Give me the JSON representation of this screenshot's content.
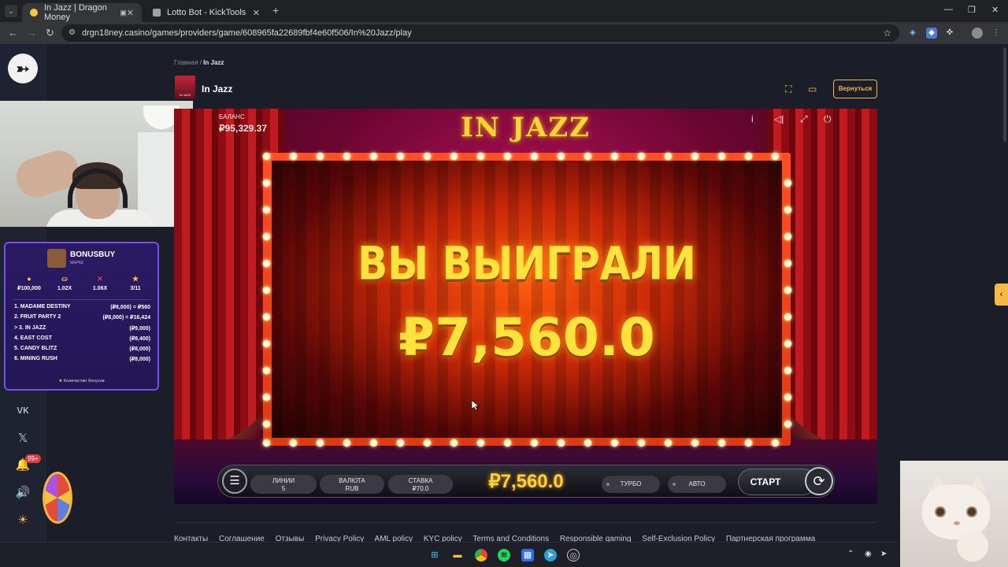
{
  "browser": {
    "tabs": [
      {
        "title": "In Jazz | Dragon Money",
        "active": true
      },
      {
        "title": "Lotto Bot - KickTools",
        "active": false
      }
    ],
    "url": "drgn18ney.casino/games/providers/game/608965fa22689fbf4e60f506/In%20Jazz/play"
  },
  "breadcrumb": {
    "home": "Главная",
    "separator": "/",
    "current": "In Jazz"
  },
  "game_header": {
    "title": "In Jazz",
    "thumb_label": "IN JAZZ",
    "back_label": "Вернуться"
  },
  "bonus_panel": {
    "title": "BONUSBUY",
    "subtitle": "МАРКЕ",
    "stats": [
      {
        "icon": "coin-icon",
        "value": "₽100,000"
      },
      {
        "icon": "pot-icon",
        "value": "1.02X"
      },
      {
        "icon": "cross-icon",
        "value": "1.06X"
      },
      {
        "icon": "star-icon",
        "value": "3/11"
      }
    ],
    "rows": [
      {
        "name": "1. MADAME DESTINY",
        "value": "(₽8,000) = ₽560"
      },
      {
        "name": "2. FRUIT PARTY 2",
        "value": "(₽8,000) = ₽16,424"
      },
      {
        "name": "> 3. IN JAZZ",
        "value": "(₽9,000)"
      },
      {
        "name": "4. EAST COST",
        "value": "(₽8,400)"
      },
      {
        "name": "5. CANDY BLITZ",
        "value": "(₽8,000)"
      },
      {
        "name": "6. MINING RUSH",
        "value": "(₽8,000)"
      }
    ],
    "footer": "Количество бонусов"
  },
  "notifications": {
    "badge": "99+"
  },
  "game": {
    "logo": "IN JAZZ",
    "balance_label": "БАЛАНС",
    "balance_value": "₽95,329.37",
    "win_title": "ВЫ ВЫИГРАЛИ",
    "win_amount": "₽7,560.0",
    "controls": {
      "lines_label": "ЛИНИИ",
      "lines_value": "5",
      "currency_label": "ВАЛЮТА",
      "currency_value": "RUB",
      "bet_label": "СТАВКА",
      "bet_value": "₽70.0",
      "win_display": "₽7,560.0",
      "turbo_label": "ТУРБО",
      "auto_label": "АВТО",
      "start_label": "СТАРТ"
    }
  },
  "footer_links": [
    "Контакты",
    "Соглашение",
    "Отзывы",
    "Privacy Policy",
    "AML policy",
    "KYC policy",
    "Terms and Conditions",
    "Responsible gaming",
    "Self-Exclusion Policy",
    "Партнерская программа"
  ],
  "colors": {
    "accent": "#f5b944",
    "page_bg": "#1b1e29",
    "win_text": "#ffe23c",
    "bonus_border": "#7a4ff0"
  }
}
